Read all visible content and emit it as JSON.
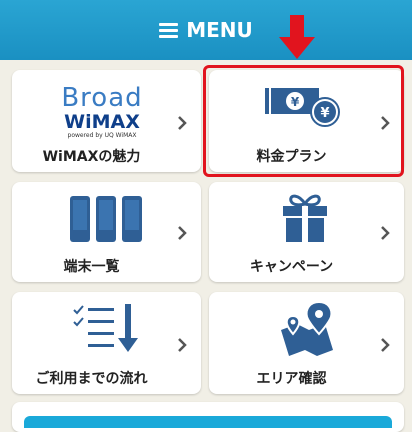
{
  "header": {
    "title": "MENU"
  },
  "cards": {
    "wimax": {
      "label": "WiMAXの魅力",
      "brand_line1": "Broad",
      "brand_line2": "WiMAX",
      "brand_line3": "powered by UQ WiMAX"
    },
    "plan": {
      "label": "料金プラン"
    },
    "device": {
      "label": "端末一覧"
    },
    "campaign": {
      "label": "キャンペーン"
    },
    "flow": {
      "label": "ご利用までの流れ"
    },
    "area": {
      "label": "エリア確認"
    }
  },
  "colors": {
    "header_blue": "#1e98c9",
    "icon_blue": "#2f5f95",
    "highlight_red": "#e1141e",
    "background": "#f1efe6"
  }
}
